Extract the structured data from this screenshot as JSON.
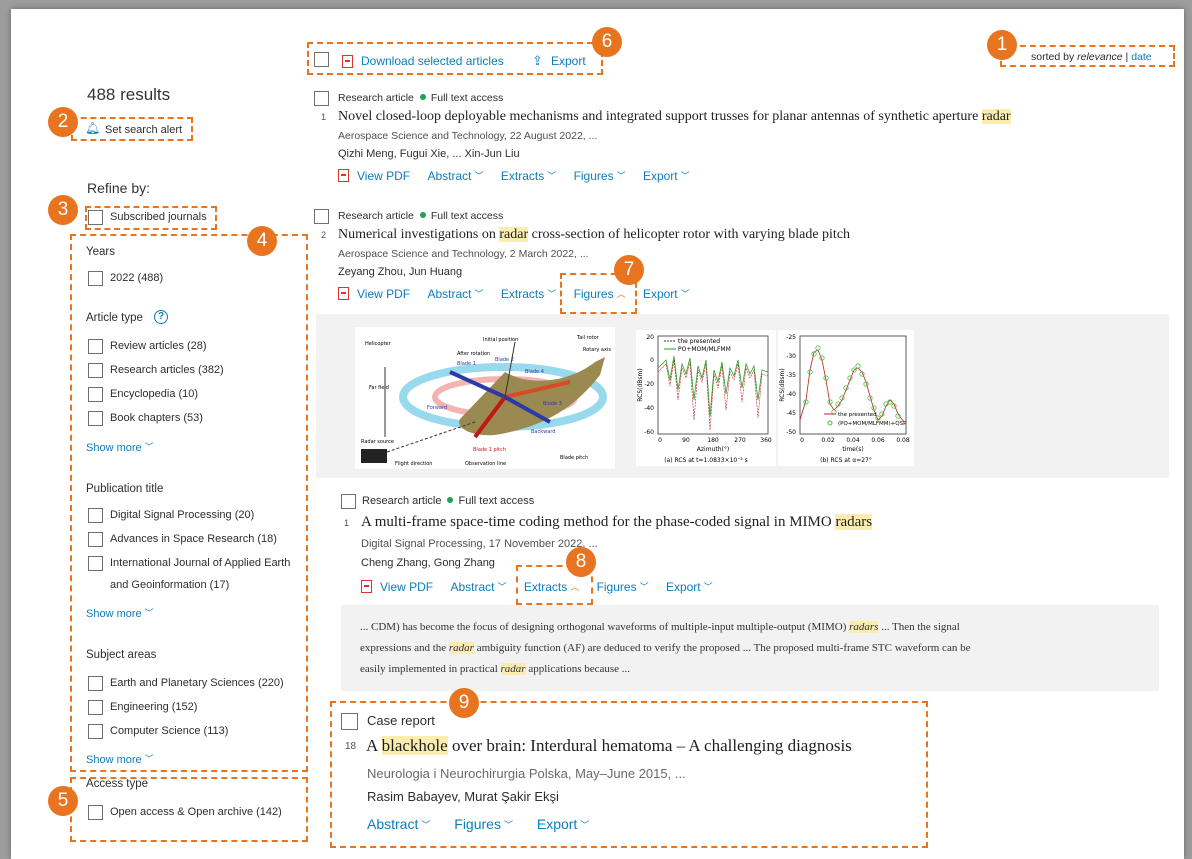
{
  "toolbar": {
    "download_label": "Download selected articles",
    "export_label": "Export"
  },
  "sort": {
    "prefix": "sorted by ",
    "relevance": "relevance",
    "sep": " | ",
    "date": "date"
  },
  "results_count": "488 results",
  "search_alert": "Set search alert",
  "refine_by": "Refine by:",
  "subscribed": "Subscribed journals",
  "years": {
    "heading": "Years",
    "items": [
      "2022 (488)"
    ]
  },
  "article_type": {
    "heading": "Article type",
    "items": [
      "Review articles (28)",
      "Research articles (382)",
      "Encyclopedia (10)",
      "Book chapters (53)"
    ],
    "show_more": "Show more"
  },
  "publication_title": {
    "heading": "Publication title",
    "items": [
      "Digital Signal Processing (20)",
      "Advances in Space Research (18)",
      "International Journal of Applied Earth",
      "and Geoinformation (17)"
    ],
    "show_more": "Show more"
  },
  "subject_areas": {
    "heading": "Subject areas",
    "items": [
      "Earth and Planetary Sciences (220)",
      "Engineering (152)",
      "Computer Science (113)"
    ],
    "show_more": "Show more"
  },
  "access_type": {
    "heading": "Access type",
    "items": [
      "Open access & Open archive (142)"
    ]
  },
  "markers": [
    "1",
    "2",
    "3",
    "4",
    "5",
    "6",
    "7",
    "8",
    "9"
  ],
  "results": [
    {
      "type": "Research article",
      "access": "Full text access",
      "num": "1",
      "title_a": "Novel closed-loop deployable mechanisms and integrated support trusses for planar antennas of synthetic aperture ",
      "title_hl": "radar",
      "title_b": "",
      "source": "Aerospace Science and Technology, 22 August 2022, ...",
      "authors": "Qizhi Meng, Fugui Xie, ... Xin-Jun Liu"
    },
    {
      "type": "Research article",
      "access": "Full text access",
      "num": "2",
      "title_a": "Numerical investigations on ",
      "title_hl": "radar",
      "title_b": " cross-section of helicopter rotor with varying blade pitch",
      "source": "Aerospace Science and Technology, 2 March 2022, ...",
      "authors": "Zeyang Zhou, Jun Huang"
    },
    {
      "type": "Research article",
      "access": "Full text access",
      "num": "1",
      "title_a": "A multi-frame space-time coding method for the phase-coded signal in MIMO ",
      "title_hl": "radars",
      "title_b": "",
      "source": "Digital Signal Processing, 17 November 2022, ...",
      "authors": "Cheng Zhang, Gong Zhang"
    },
    {
      "type": "Case report",
      "num": "18",
      "title_a": "A ",
      "title_hl": "blackhole",
      "title_b": " over brain: Interdural hematoma – A challenging diagnosis",
      "source": "Neurologia i Neurochirurgia Polska, May–June 2015, ...",
      "authors": "Rasim Babayev, Murat Şakir Ekşi"
    }
  ],
  "actions": {
    "view_pdf": "View PDF",
    "abstract": "Abstract",
    "extracts": "Extracts",
    "figures": "Figures",
    "export": "Export"
  },
  "extract": {
    "l1a": "... CDM) has become the focus of designing orthogonal waveforms of multiple-input multiple-output (MIMO) ",
    "l1h": "radars",
    "l1b": " ... Then the signal",
    "l2a": "expressions and the ",
    "l2h": "radar",
    "l2b": " ambiguity function (AF) are deduced to verify the proposed ... The proposed multi-frame STC waveform can be",
    "l3a": "easily implemented in practical ",
    "l3h": "radar",
    "l3b": " applications because ..."
  },
  "figure_a": {
    "labels": [
      "Helicopter",
      "Far field",
      "Initial position",
      "After rotation",
      "Blade 1",
      "Blade 2",
      "Blade 3",
      "Blade 4",
      "Forward",
      "Backward",
      "Blade 1 pitch",
      "Radar source",
      "Flight direction",
      "Observation line",
      "Blade pitch",
      "Tail rotor",
      "Rotary axis"
    ]
  },
  "figure_b": {
    "legend": [
      "the presented",
      "PO+MOM/MLFMM"
    ],
    "ylabel": "RCS(dBsm)",
    "xlabel": "Azimuth(°)",
    "yticks": [
      "20",
      "0",
      "-20",
      "-40",
      "-60"
    ],
    "xticks": [
      "0",
      "90",
      "180",
      "270",
      "360"
    ],
    "caption": "(a)  RCS at t=1.0833×10⁻² s"
  },
  "figure_c": {
    "legend": [
      "the presented",
      "(PO+MOM/MLFMM)+QSP"
    ],
    "ylabel": "RCS(dBsm)",
    "xlabel": "time(s)",
    "yticks": [
      "-25",
      "-30",
      "-35",
      "-40",
      "-45",
      "-50"
    ],
    "xticks": [
      "0",
      "0.02",
      "0.04",
      "0.06",
      "0.08"
    ],
    "caption": "(b)  RCS at α=27°"
  },
  "colors": {
    "accent": "#e8741f",
    "link": "#0c7dbb",
    "highlight": "#fbedb0",
    "open_access": "#20a05a"
  }
}
